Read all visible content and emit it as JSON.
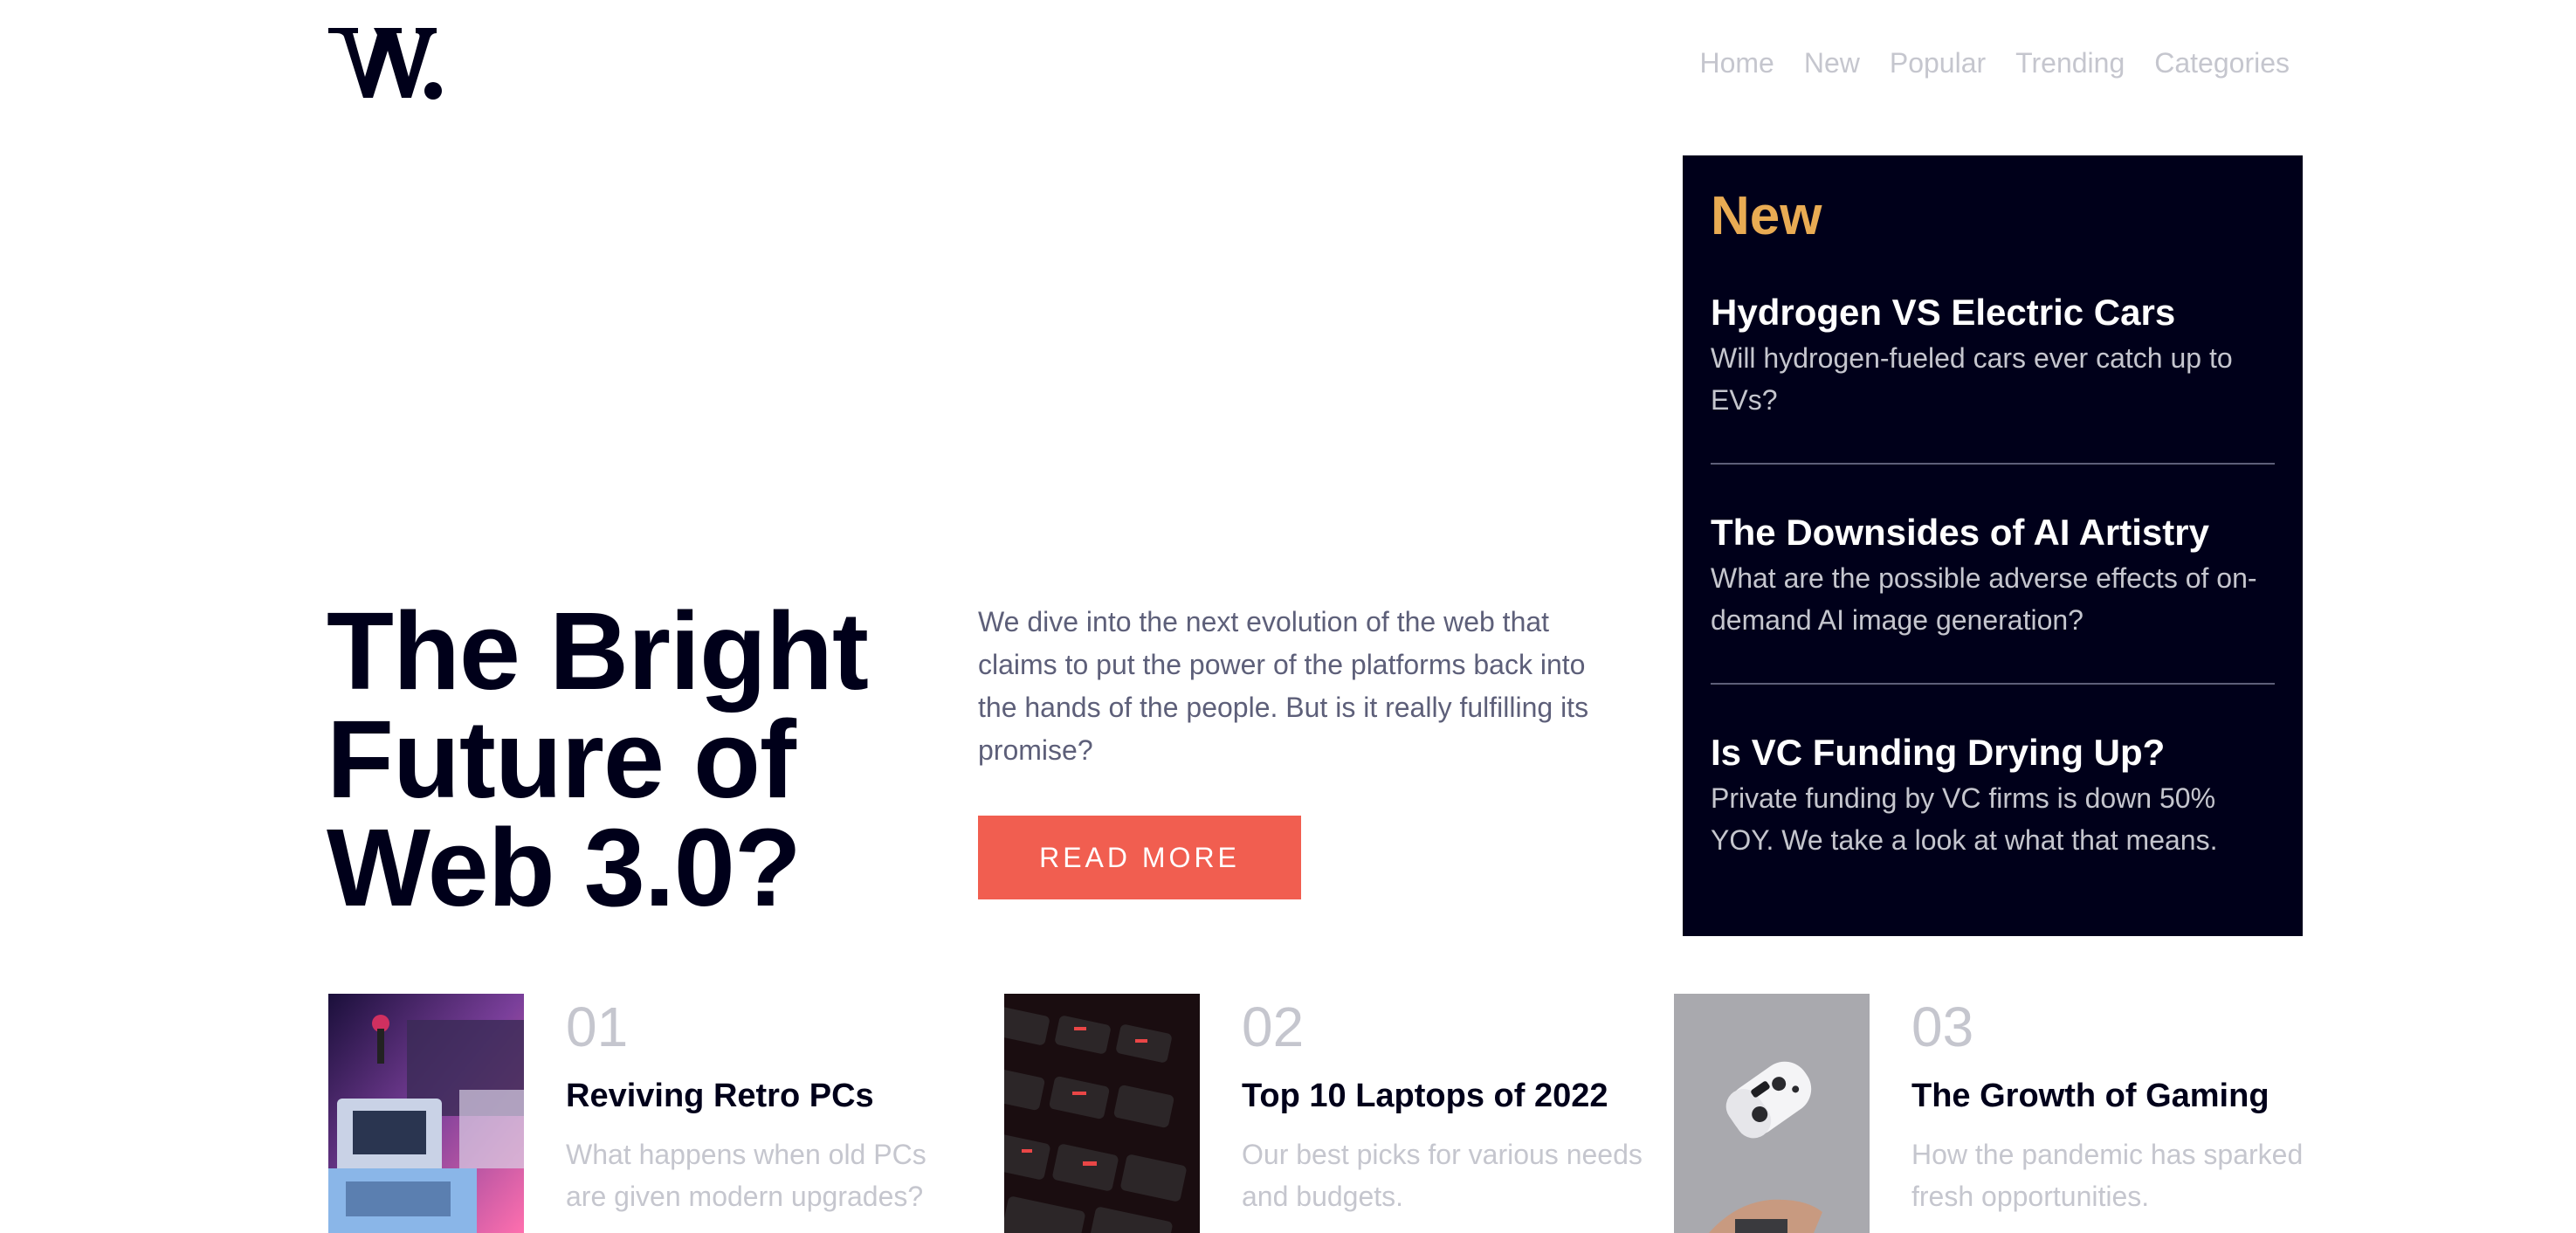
{
  "logo": {
    "text": "W."
  },
  "nav": [
    "Home",
    "New",
    "Popular",
    "Trending",
    "Categories"
  ],
  "hero": {
    "title": "The Bright Future of Web 3.0?",
    "description": "We dive into the next evolution of the web that claims to put the power of the platforms back into the hands of the people. But is it really fulfilling its promise?",
    "button": "READ MORE"
  },
  "new_panel": {
    "title": "New",
    "items": [
      {
        "title": "Hydrogen VS Electric Cars",
        "description": "Will hydrogen-fueled cars ever catch up to EVs?"
      },
      {
        "title": "The Downsides of AI Artistry",
        "description": "What are the possible adverse effects of on-demand AI image generation?"
      },
      {
        "title": "Is VC Funding Drying Up?",
        "description": "Private funding by VC firms is down 50% YOY. We take a look at what that means."
      }
    ]
  },
  "articles": [
    {
      "number": "01",
      "title": "Reviving Retro PCs",
      "description": "What happens when old PCs are given modern upgrades?"
    },
    {
      "number": "02",
      "title": "Top 10 Laptops of 2022",
      "description": "Our best picks for various needs and budgets."
    },
    {
      "number": "03",
      "title": "The Growth of Gaming",
      "description": "How the pandemic has sparked fresh opportunities."
    }
  ],
  "colors": {
    "dark_navy": "#00001a",
    "accent_red": "#f15e50",
    "accent_orange": "#e9ab53",
    "grayish_blue": "#5d5f79",
    "light_gray": "#c5c6ce"
  }
}
